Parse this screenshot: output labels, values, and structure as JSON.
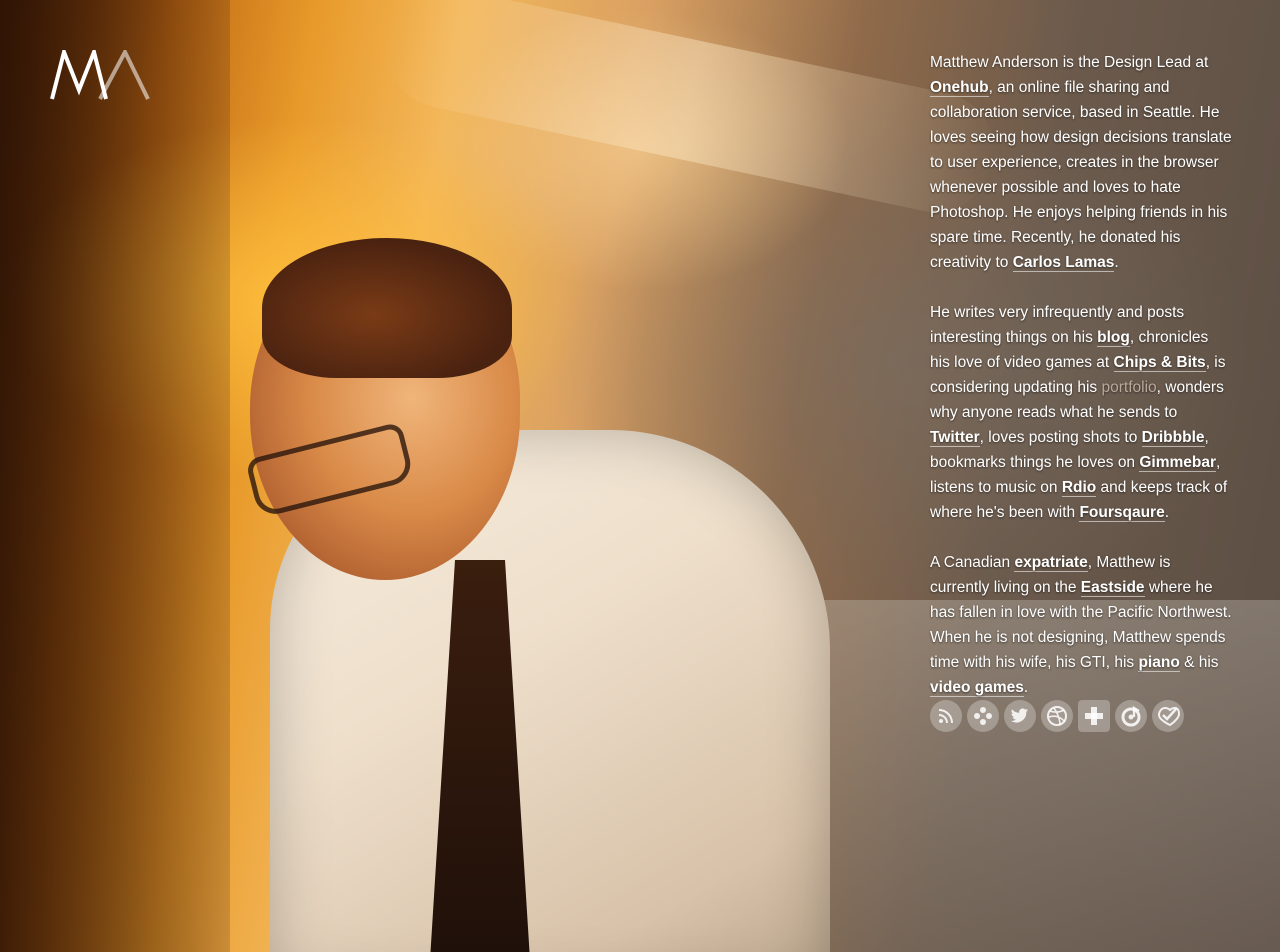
{
  "logo": {
    "text": "MA"
  },
  "bio": {
    "p1": {
      "t1": "Matthew Anderson is the Design Lead at ",
      "link_onehub": "Onehub",
      "t2": ", an online file sharing and collaboration service, based in Seattle. He loves seeing how design decisions translate to user experience, creates in the browser whenever possible and loves to hate Photoshop. He enjoys helping friends in his spare time. Recently, he donated his creativity to ",
      "link_carlos": "Carlos Lamas",
      "t3": "."
    },
    "p2": {
      "t1": "He writes very infrequently and posts interesting things on his ",
      "link_blog": "blog",
      "t2": ", chronicles his love of video games at ",
      "link_chips": "Chips & Bits",
      "t3": ", is considering updating his ",
      "link_portfolio": "portfolio",
      "t4": ", wonders why anyone reads what he sends to ",
      "link_twitter": "Twitter",
      "t5": ", loves posting shots to ",
      "link_dribbble": "Dribbble",
      "t6": ", bookmarks things he loves on ",
      "link_gimmebar": "Gimmebar",
      "t7": ", listens to music on ",
      "link_rdio": "Rdio",
      "t8": " and keeps track of where he's been with ",
      "link_foursquare": "Foursqaure",
      "t9": "."
    },
    "p3": {
      "t1": "A Canadian ",
      "link_expatriate": "expatriate",
      "t2": ", Matthew is currently living on the ",
      "link_eastside": "Eastside",
      "t3": " where he has fallen in love with the Pacific Northwest. When he is not designing, Matthew spends time with his wife, his GTI, his ",
      "link_piano": "piano",
      "t4": " & his ",
      "link_games": "video games",
      "t5": "."
    }
  },
  "social": [
    {
      "icon": "rss-icon"
    },
    {
      "icon": "chips-bits-icon"
    },
    {
      "icon": "twitter-icon"
    },
    {
      "icon": "dribbble-icon"
    },
    {
      "icon": "gimmebar-icon"
    },
    {
      "icon": "rdio-icon"
    },
    {
      "icon": "foursquare-icon"
    }
  ]
}
